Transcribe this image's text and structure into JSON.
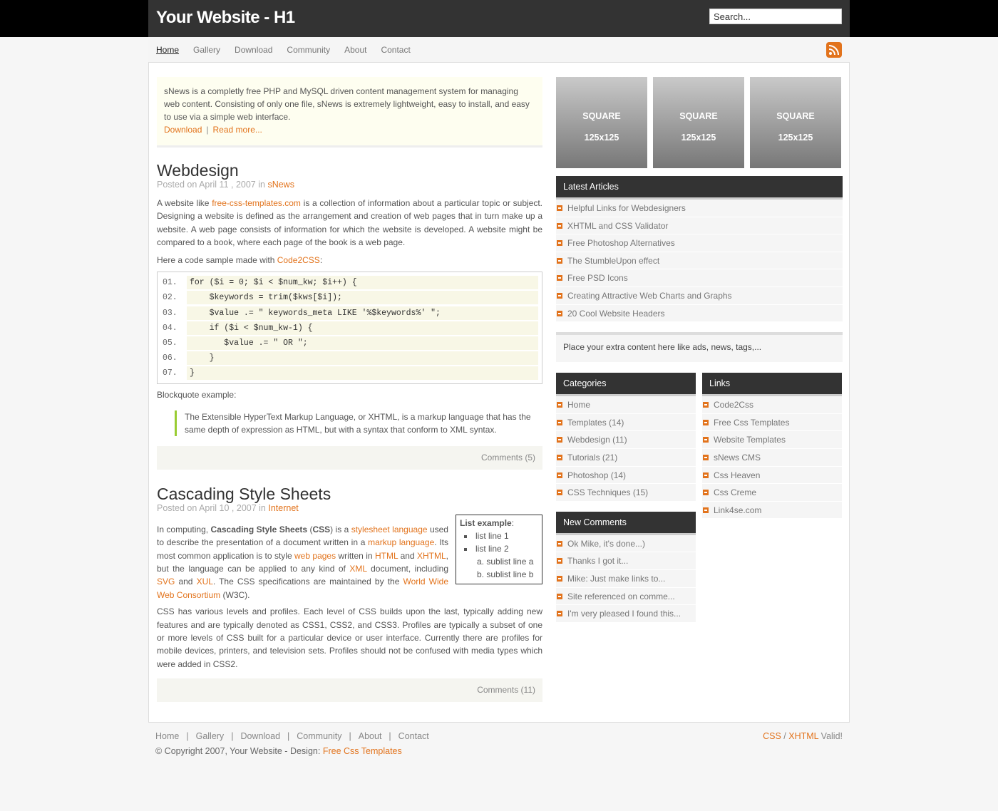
{
  "site": {
    "title": "Your Website - H1",
    "search_placeholder": "Search..."
  },
  "nav": [
    "Home",
    "Gallery",
    "Download",
    "Community",
    "About",
    "Contact"
  ],
  "intro": {
    "text": "sNews is a completly free PHP and MySQL driven content management system for managing web content. Consisting of only one file, sNews is extremely lightweight, easy to install, and easy to use via a simple web interface.",
    "download": "Download",
    "sep": "|",
    "readmore": "Read more..."
  },
  "post1": {
    "title": "Webdesign",
    "meta_prefix": "Posted on April 11 , 2007 in",
    "meta_cat": "sNews",
    "p1_a": "A website like",
    "p1_link": "free-css-templates.com",
    "p1_b": "is a collection of information about a particular topic or subject. Designing a website is defined as the arrangement and creation of web pages that in turn make up a website. A web page consists of information for which the website is developed. A website might be compared to a book, where each page of the book is a web page.",
    "p2_a": "Here a code sample made with",
    "p2_link": "Code2CSS",
    "p2_b": ":",
    "code": [
      {
        "n": "01.",
        "t": "for ($i = 0; $i < $num_kw; $i++) {"
      },
      {
        "n": "02.",
        "t": "    $keywords = trim($kws[$i]);"
      },
      {
        "n": "03.",
        "t": "    $value .= \" keywords_meta LIKE '%$keywords%' \";"
      },
      {
        "n": "04.",
        "t": "    if ($i < $num_kw-1) {"
      },
      {
        "n": "05.",
        "t": "       $value .= \" OR \";"
      },
      {
        "n": "06.",
        "t": "    }"
      },
      {
        "n": "07.",
        "t": "}"
      }
    ],
    "bq_label": "Blockquote example:",
    "bq": "The Extensible HyperText Markup Language, or XHTML, is a markup language that has the same depth of expression as HTML, but with a syntax that conform to XML syntax.",
    "comments": "Comments (5)"
  },
  "post2": {
    "title": "Cascading Style Sheets",
    "meta_prefix": "Posted on April 10 , 2007 in",
    "meta_cat": "Internet",
    "list_title": "List example",
    "list_colon": ":",
    "list_items": [
      "list line 1",
      "list line 2"
    ],
    "sublist": [
      "a. sublist line a",
      "b. sublist line b"
    ],
    "t1": "In computing,",
    "b1": "Cascading Style Sheets",
    "t2": "(",
    "b2": "CSS",
    "t3": ") is a",
    "l1": "stylesheet language",
    "t4": "used to describe the presentation of a document written in a",
    "l2": "markup language",
    "t5": ". Its most common application is to style",
    "l3": "web pages",
    "t6": "written in",
    "l4": "HTML",
    "t7": "and",
    "l5": "XHTML",
    "t8": ", but the language can be applied to any kind of",
    "l6": "XML",
    "t9": "document, including",
    "l7": "SVG",
    "t10": "and",
    "l8": "XUL",
    "t11": ". The CSS specifications are maintained by the",
    "l9": "World Wide Web Consortium",
    "t12": "(W3C).",
    "p2": "CSS has various levels and profiles. Each level of CSS builds upon the last, typically adding new features and are typically denoted as CSS1, CSS2, and CSS3. Profiles are typically a subset of one or more levels of CSS built for a particular device or user interface. Currently there are profiles for mobile devices, printers, and television sets. Profiles should not be confused with media types which were added in CSS2.",
    "comments": "Comments (11)"
  },
  "squares": [
    {
      "l1": "SQUARE",
      "l2": "125x125"
    },
    {
      "l1": "SQUARE",
      "l2": "125x125"
    },
    {
      "l1": "SQUARE",
      "l2": "125x125"
    }
  ],
  "latest": {
    "title": "Latest Articles",
    "items": [
      "Helpful Links for Webdesigners",
      "XHTML and CSS Validator",
      "Free Photoshop Alternatives",
      "The StumbleUpon effect",
      "Free PSD Icons",
      "Creating Attractive Web Charts and Graphs",
      "20 Cool Website Headers"
    ]
  },
  "extra": "Place your extra content here like ads, news, tags,...",
  "categories": {
    "title": "Categories",
    "items": [
      "Home",
      "Templates (14)",
      "Webdesign (11)",
      "Tutorials (21)",
      "Photoshop (14)",
      "CSS Techniques (15)"
    ]
  },
  "links": {
    "title": "Links",
    "items": [
      "Code2Css",
      "Free Css Templates",
      "Website Templates",
      "sNews CMS",
      "Css Heaven",
      "Css Creme",
      "Link4se.com"
    ]
  },
  "comments_box": {
    "title": "New Comments",
    "items": [
      "Ok Mike, it's done...)",
      "Thanks I got it...",
      "Mike: Just make links to...",
      "Site referenced on comme...",
      "I'm very pleased I found this..."
    ]
  },
  "footer": {
    "nav": [
      "Home",
      "Gallery",
      "Download",
      "Community",
      "About",
      "Contact"
    ],
    "sep": "|",
    "copy": "© Copyright 2007, Your Website - Design:",
    "copy_link": "Free Css Templates",
    "v_css": "CSS",
    "v_slash": "/",
    "v_xhtml": "XHTML",
    "v_valid": "Valid!"
  }
}
